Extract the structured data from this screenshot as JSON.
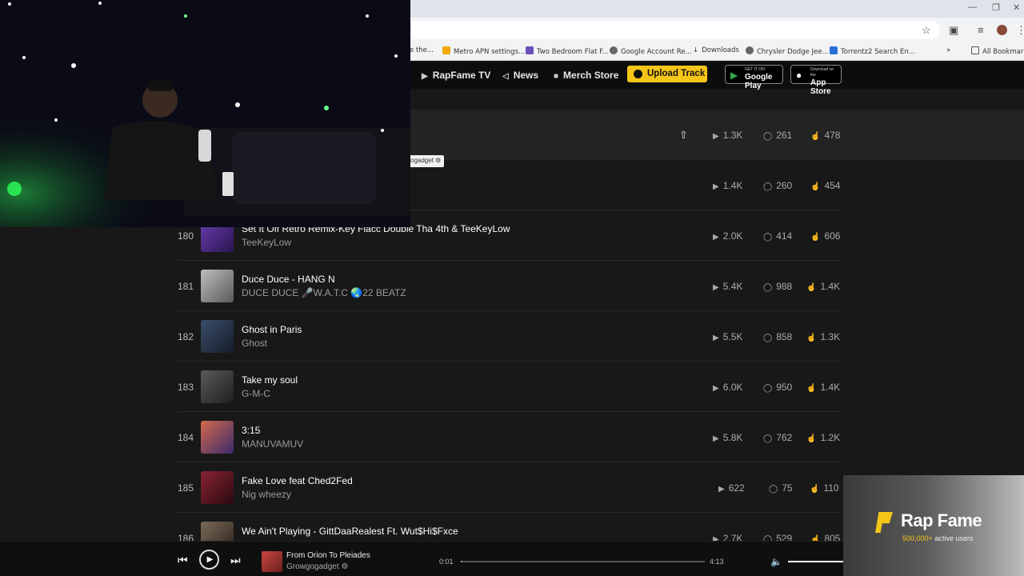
{
  "browser": {
    "bookmarks": [
      {
        "label": "e the..."
      },
      {
        "label": "Metro APN settings..."
      },
      {
        "label": "Two Bedroom Flat F..."
      },
      {
        "label": "Google Account Re..."
      },
      {
        "label": "Downloads"
      },
      {
        "label": "Chrysler Dodge Jee..."
      },
      {
        "label": "Torrentz2 Search En..."
      },
      {
        "label": "All Bookmarks"
      }
    ]
  },
  "nav": {
    "items": [
      "RapFame TV",
      "News",
      "Merch Store"
    ],
    "upload_label": "Upload Track",
    "google_play_small": "GET IT ON",
    "google_play": "Google Play",
    "app_store_small": "Download on the",
    "app_store": "App Store"
  },
  "tag_label": "ogadget",
  "tracks": [
    {
      "num": "",
      "title": "",
      "artist": "",
      "plays": "1.3K",
      "comments": "261",
      "likes": "478",
      "highlight": true
    },
    {
      "num": "",
      "title": "",
      "artist": "",
      "plays": "1.4K",
      "comments": "260",
      "likes": "454"
    },
    {
      "num": "180",
      "title": "Set It Off Retro Remix-Key Flacc Double Tha 4th & TeeKeyLow",
      "artist": "TeeKeyLow",
      "plays": "2.0K",
      "comments": "414",
      "likes": "606",
      "thumb": "#4a2f7a"
    },
    {
      "num": "181",
      "title": "Duce Duce - HANG N",
      "artist": "DUCE DUCE 🎤W.A.T.C 🌏22 BEATZ",
      "plays": "5.4K",
      "comments": "988",
      "likes": "1.4K",
      "thumb": "#8a8a8a"
    },
    {
      "num": "182",
      "title": "Ghost in Paris",
      "artist": "Ghost",
      "plays": "5.5K",
      "comments": "858",
      "likes": "1.3K",
      "thumb": "#2f3d52"
    },
    {
      "num": "183",
      "title": "Take my soul",
      "artist": "G-M-C",
      "plays": "6.0K",
      "comments": "950",
      "likes": "1.4K",
      "thumb": "#3b3b3b"
    },
    {
      "num": "184",
      "title": "3:15",
      "artist": "MANUVAMUV",
      "plays": "5.8K",
      "comments": "762",
      "likes": "1.2K",
      "thumb": "#b2463a"
    },
    {
      "num": "185",
      "title": "Fake Love feat Ched2Fed",
      "artist": "Nig wheezy",
      "plays": "622",
      "comments": "75",
      "likes": "110",
      "thumb": "#6e1c24"
    },
    {
      "num": "186",
      "title": "We Ain't Playing - GittDaaRealest Ft. Wut$Hi$Fxce",
      "artist": "",
      "plays": "2.7K",
      "comments": "529",
      "likes": "805",
      "thumb": "#5a4a3a"
    }
  ],
  "player": {
    "title": "From Orion To Pleiades",
    "artist": "Growgogadget",
    "elapsed": "0:01",
    "duration": "4:13",
    "progress": 0.004,
    "volume": 1.0
  },
  "promo": {
    "title": "Rap Fame",
    "users_count": "500,000+",
    "users_label": "active users"
  },
  "colors": {
    "accent": "#f5c518",
    "background": "#181818"
  }
}
